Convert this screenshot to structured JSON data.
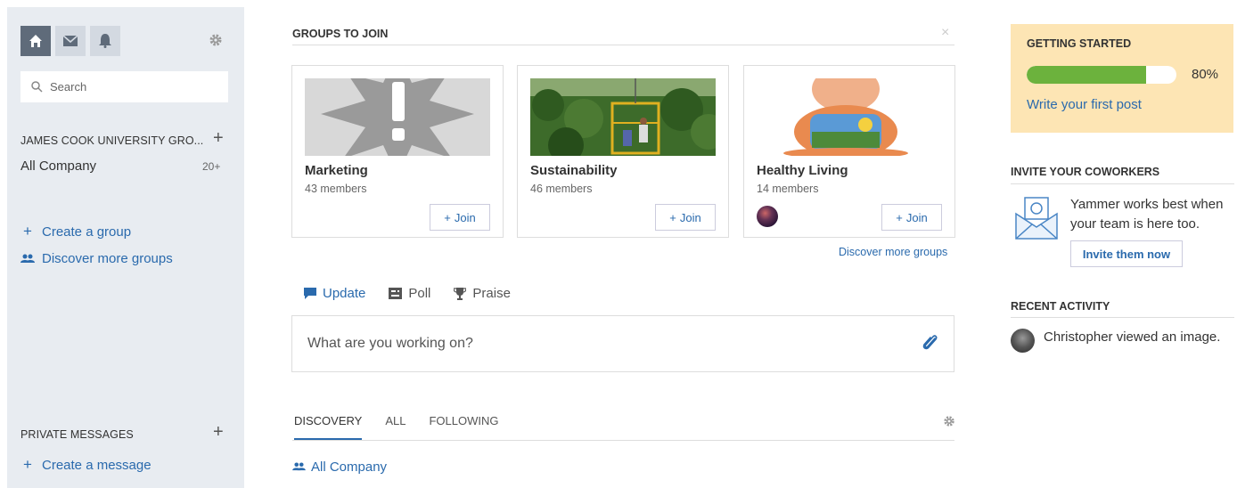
{
  "sidebar": {
    "search_placeholder": "Search",
    "network_title": "JAMES COOK UNIVERSITY GRO...",
    "all_company": "All Company",
    "all_company_count": "20+",
    "create_group": "Create a group",
    "discover_groups": "Discover more groups",
    "private_messages_title": "PRIVATE MESSAGES",
    "create_message": "Create a message",
    "plus": "+"
  },
  "groups": {
    "title": "GROUPS TO JOIN",
    "close": "×",
    "join_label": "Join",
    "join_plus": "+",
    "cards": [
      {
        "name": "Marketing",
        "members": "43 members"
      },
      {
        "name": "Sustainability",
        "members": "46 members"
      },
      {
        "name": "Healthy Living",
        "members": "14 members"
      }
    ],
    "discover_link": "Discover more groups"
  },
  "publisher": {
    "tabs": [
      {
        "label": "Update",
        "icon": "speech-bubble-icon"
      },
      {
        "label": "Poll",
        "icon": "poll-icon"
      },
      {
        "label": "Praise",
        "icon": "trophy-icon"
      }
    ],
    "placeholder": "What are you working on?"
  },
  "feed": {
    "tabs": [
      "DISCOVERY",
      "ALL",
      "FOLLOWING"
    ],
    "group_label": "All Company"
  },
  "getting_started": {
    "title": "GETTING STARTED",
    "progress": 80,
    "percent_label": "80%",
    "link": "Write your first post"
  },
  "invite": {
    "title": "INVITE YOUR COWORKERS",
    "text": "Yammer works best when your team is here too.",
    "button": "Invite them now"
  },
  "recent": {
    "title": "RECENT ACTIVITY",
    "text": "Christopher viewed an image."
  },
  "colors": {
    "accent": "#2a6aad",
    "sidebar_bg": "#e8ecf1",
    "getting_started_bg": "#fde5b4",
    "progress": "#6cb23d"
  }
}
